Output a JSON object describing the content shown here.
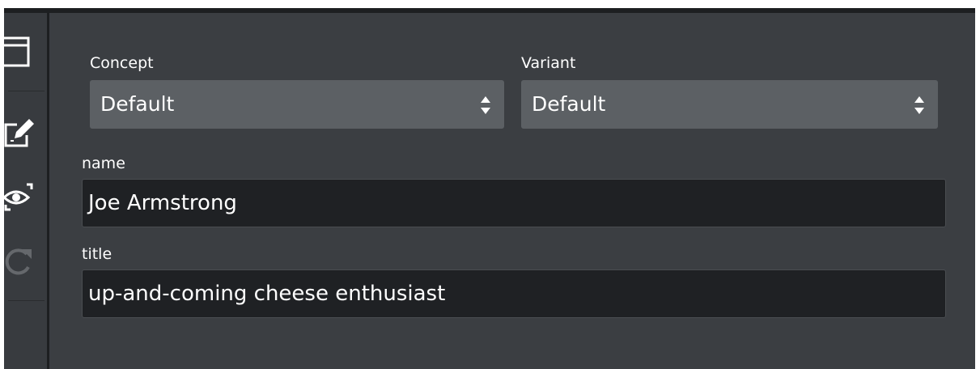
{
  "sidebar": {
    "icons": [
      "window-icon",
      "edit-icon",
      "preview-icon",
      "refresh-icon"
    ]
  },
  "form": {
    "concept": {
      "label": "Concept",
      "value": "Default"
    },
    "variant": {
      "label": "Variant",
      "value": "Default"
    },
    "name": {
      "label": "name",
      "value": "Joe Armstrong"
    },
    "title": {
      "label": "title",
      "value": "up-and-coming cheese enthusiast"
    }
  },
  "colors": {
    "background": "#3b3e42",
    "select_background": "#5c6064",
    "field_background": "#1f2124",
    "text": "#ffffff"
  }
}
